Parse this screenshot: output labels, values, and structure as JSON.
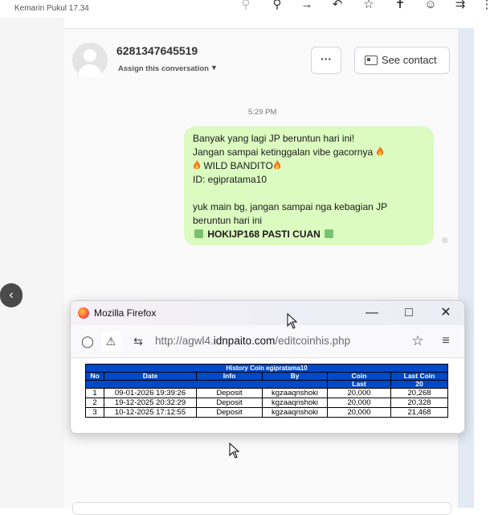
{
  "top_bar": {
    "timestamp": "Kemarin Pukul 17.34",
    "icons": [
      "zoom-icon",
      "forward-icon",
      "reply-icon",
      "star-icon",
      "pin-icon",
      "emoji-icon",
      "reply-all-icon"
    ]
  },
  "conversation": {
    "contact_number": "6281347645519",
    "assign_label": "Assign this conversation",
    "more_label": "···",
    "see_contact_label": "See contact",
    "message_time": "5:29 PM",
    "message_lines": [
      "Banyak yang lagi JP beruntun hari ini!",
      "Jangan sampai ketinggalan vibe gacornya",
      "WILD BANDITO",
      "ID:  egipratama10",
      "",
      "yuk main  bg, jangan sampai nga kebagian JP",
      "beruntun hari ini",
      "HOKIJP168 PASTI CUAN"
    ]
  },
  "firefox": {
    "title": "Mozilla Firefox",
    "url_prefix": "http://agwl4.",
    "url_domain": "idnpaito.com",
    "url_path": "/editcoinhis.php"
  },
  "history_table": {
    "caption": "History Coin egipratama10",
    "headers": [
      "No",
      "Date",
      "Info",
      "By",
      "Coin",
      "Last Coin"
    ],
    "subrow": {
      "coin": "Last",
      "last_coin": "20"
    },
    "rows": [
      [
        "1",
        "09-01-2026 19:39:26",
        "Deposit",
        "kgzaaqrishoki",
        "20,000",
        "20,268"
      ],
      [
        "2",
        "19-12-2025 20:32:29",
        "Deposit",
        "kgzaaqrishoki",
        "20,000",
        "20,328"
      ],
      [
        "3",
        "10-12-2025 17:12:55",
        "Deposit",
        "kgzaaqrishoki",
        "20,000",
        "21,468"
      ]
    ]
  },
  "colors": {
    "bubble": "#dcfbc0",
    "table_header": "#0049c9",
    "accent_strip": "#e3eaf3"
  }
}
